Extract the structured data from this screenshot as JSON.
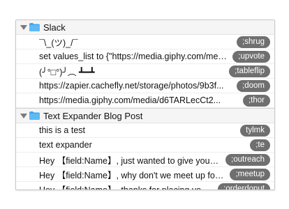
{
  "groups": [
    {
      "name": "Slack",
      "items": [
        {
          "text": "¯\\_(ツ)_/¯",
          "abbr": ";shrug"
        },
        {
          "text": "set values_list to {\"https://media.giphy.com/media/...",
          "abbr": ";upvote"
        },
        {
          "text": "(╯°□°)╯︵ ┻━┻",
          "abbr": ";tableflip"
        },
        {
          "text": "https://zapier.cachefly.net/storage/photos/9b3f...",
          "abbr": ";doom"
        },
        {
          "text": "https://media.giphy.com/media/d6TARLecCt2...",
          "abbr": ";thor"
        }
      ]
    },
    {
      "name": "Text Expander Blog Post",
      "items": [
        {
          "text": "this is a test",
          "abbr": "tylmk"
        },
        {
          "text": "text expander",
          "abbr": ";te"
        },
        {
          "text": "Hey 【field:Name】, just wanted to give you a quick...",
          "abbr": ";outreach"
        },
        {
          "text": "Hey 【field:Name】, why don't we meet up for coffee...",
          "abbr": ";meetup"
        },
        {
          "text": "Hey 【field:Name】, thanks for placing your order...",
          "abbr": ";orderdonut"
        }
      ]
    }
  ],
  "colors": {
    "folder": "#3aa8f0",
    "pill": "#6f6f6f",
    "disclosure": "#7a7a7a"
  }
}
